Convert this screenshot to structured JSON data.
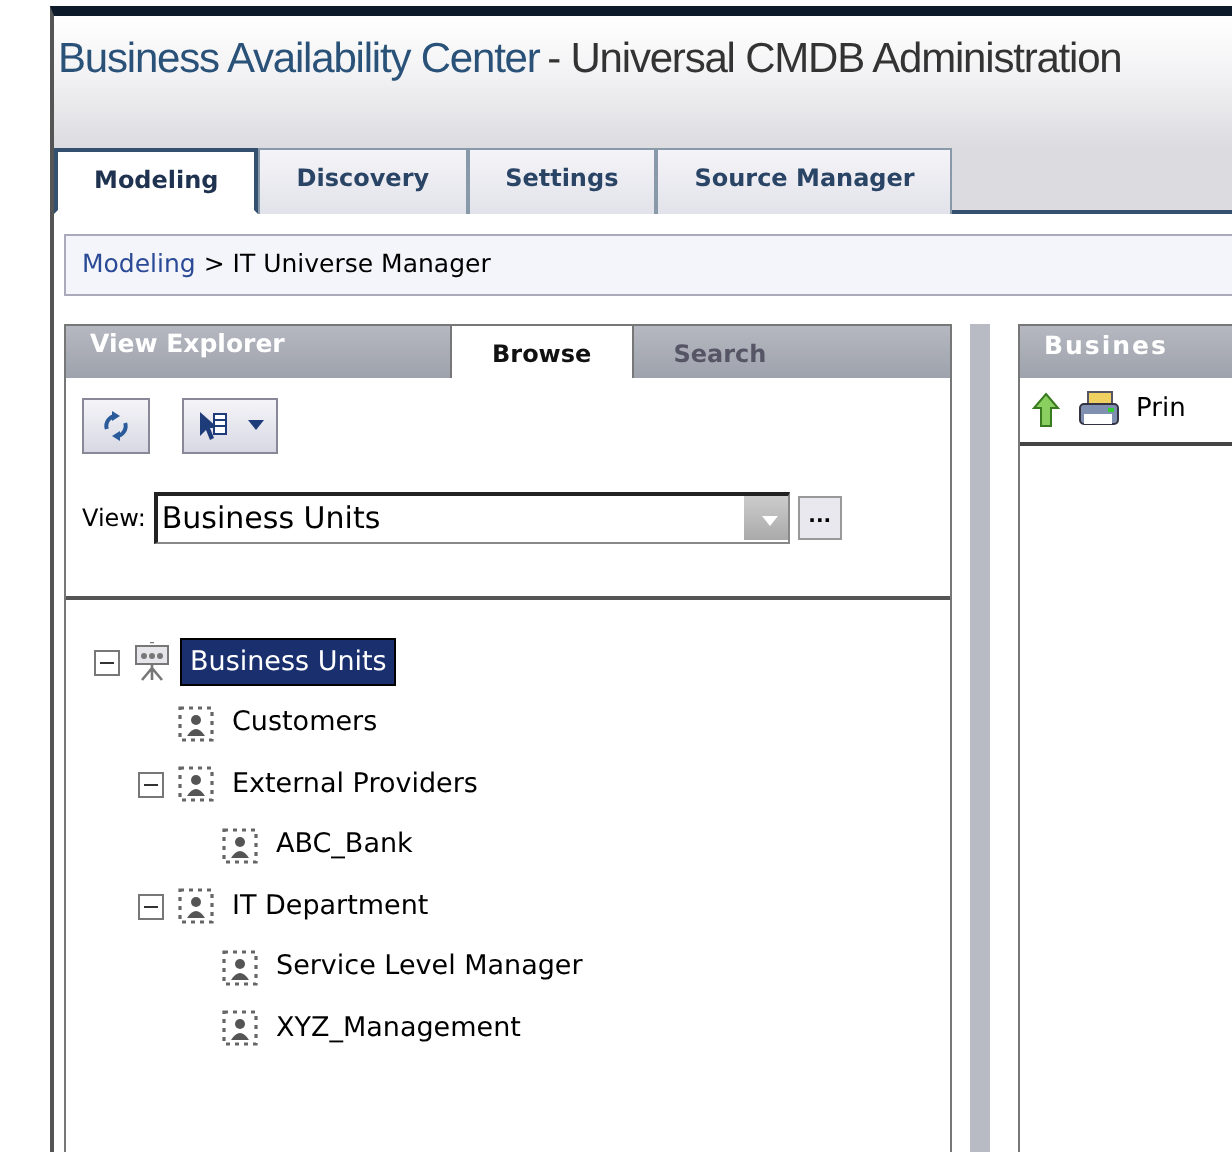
{
  "window": {
    "title": "Business Availability Center",
    "subtitle": "- Universal CMDB Administration"
  },
  "tabs": [
    {
      "label": "Modeling",
      "selected": true
    },
    {
      "label": "Discovery",
      "selected": false
    },
    {
      "label": "Settings",
      "selected": false
    },
    {
      "label": "Source Manager",
      "selected": false
    }
  ],
  "breadcrumb": {
    "link": "Modeling",
    "rest": "> IT Universe Manager"
  },
  "view_explorer": {
    "title": "View Explorer",
    "tabs": [
      {
        "label": "Browse",
        "selected": true
      },
      {
        "label": "Search",
        "selected": false
      }
    ],
    "view_label": "View:",
    "view_value": "Business Units",
    "browse_button": "...",
    "tree": [
      {
        "label": "Business Units",
        "kind": "view",
        "selected": true,
        "expanded": true,
        "children": [
          {
            "label": "Customers",
            "kind": "unit",
            "selected": false
          },
          {
            "label": "External Providers",
            "kind": "unit",
            "selected": false,
            "expanded": true,
            "children": [
              {
                "label": "ABC_Bank",
                "kind": "unit",
                "selected": false
              }
            ]
          },
          {
            "label": "IT Department",
            "kind": "unit",
            "selected": false,
            "expanded": true,
            "children": [
              {
                "label": "Service Level Manager",
                "kind": "unit",
                "selected": false
              },
              {
                "label": "XYZ_Management",
                "kind": "unit",
                "selected": false
              }
            ]
          }
        ]
      }
    ]
  },
  "right_panel": {
    "title": "Busines",
    "toolbar_label": "Prin"
  }
}
